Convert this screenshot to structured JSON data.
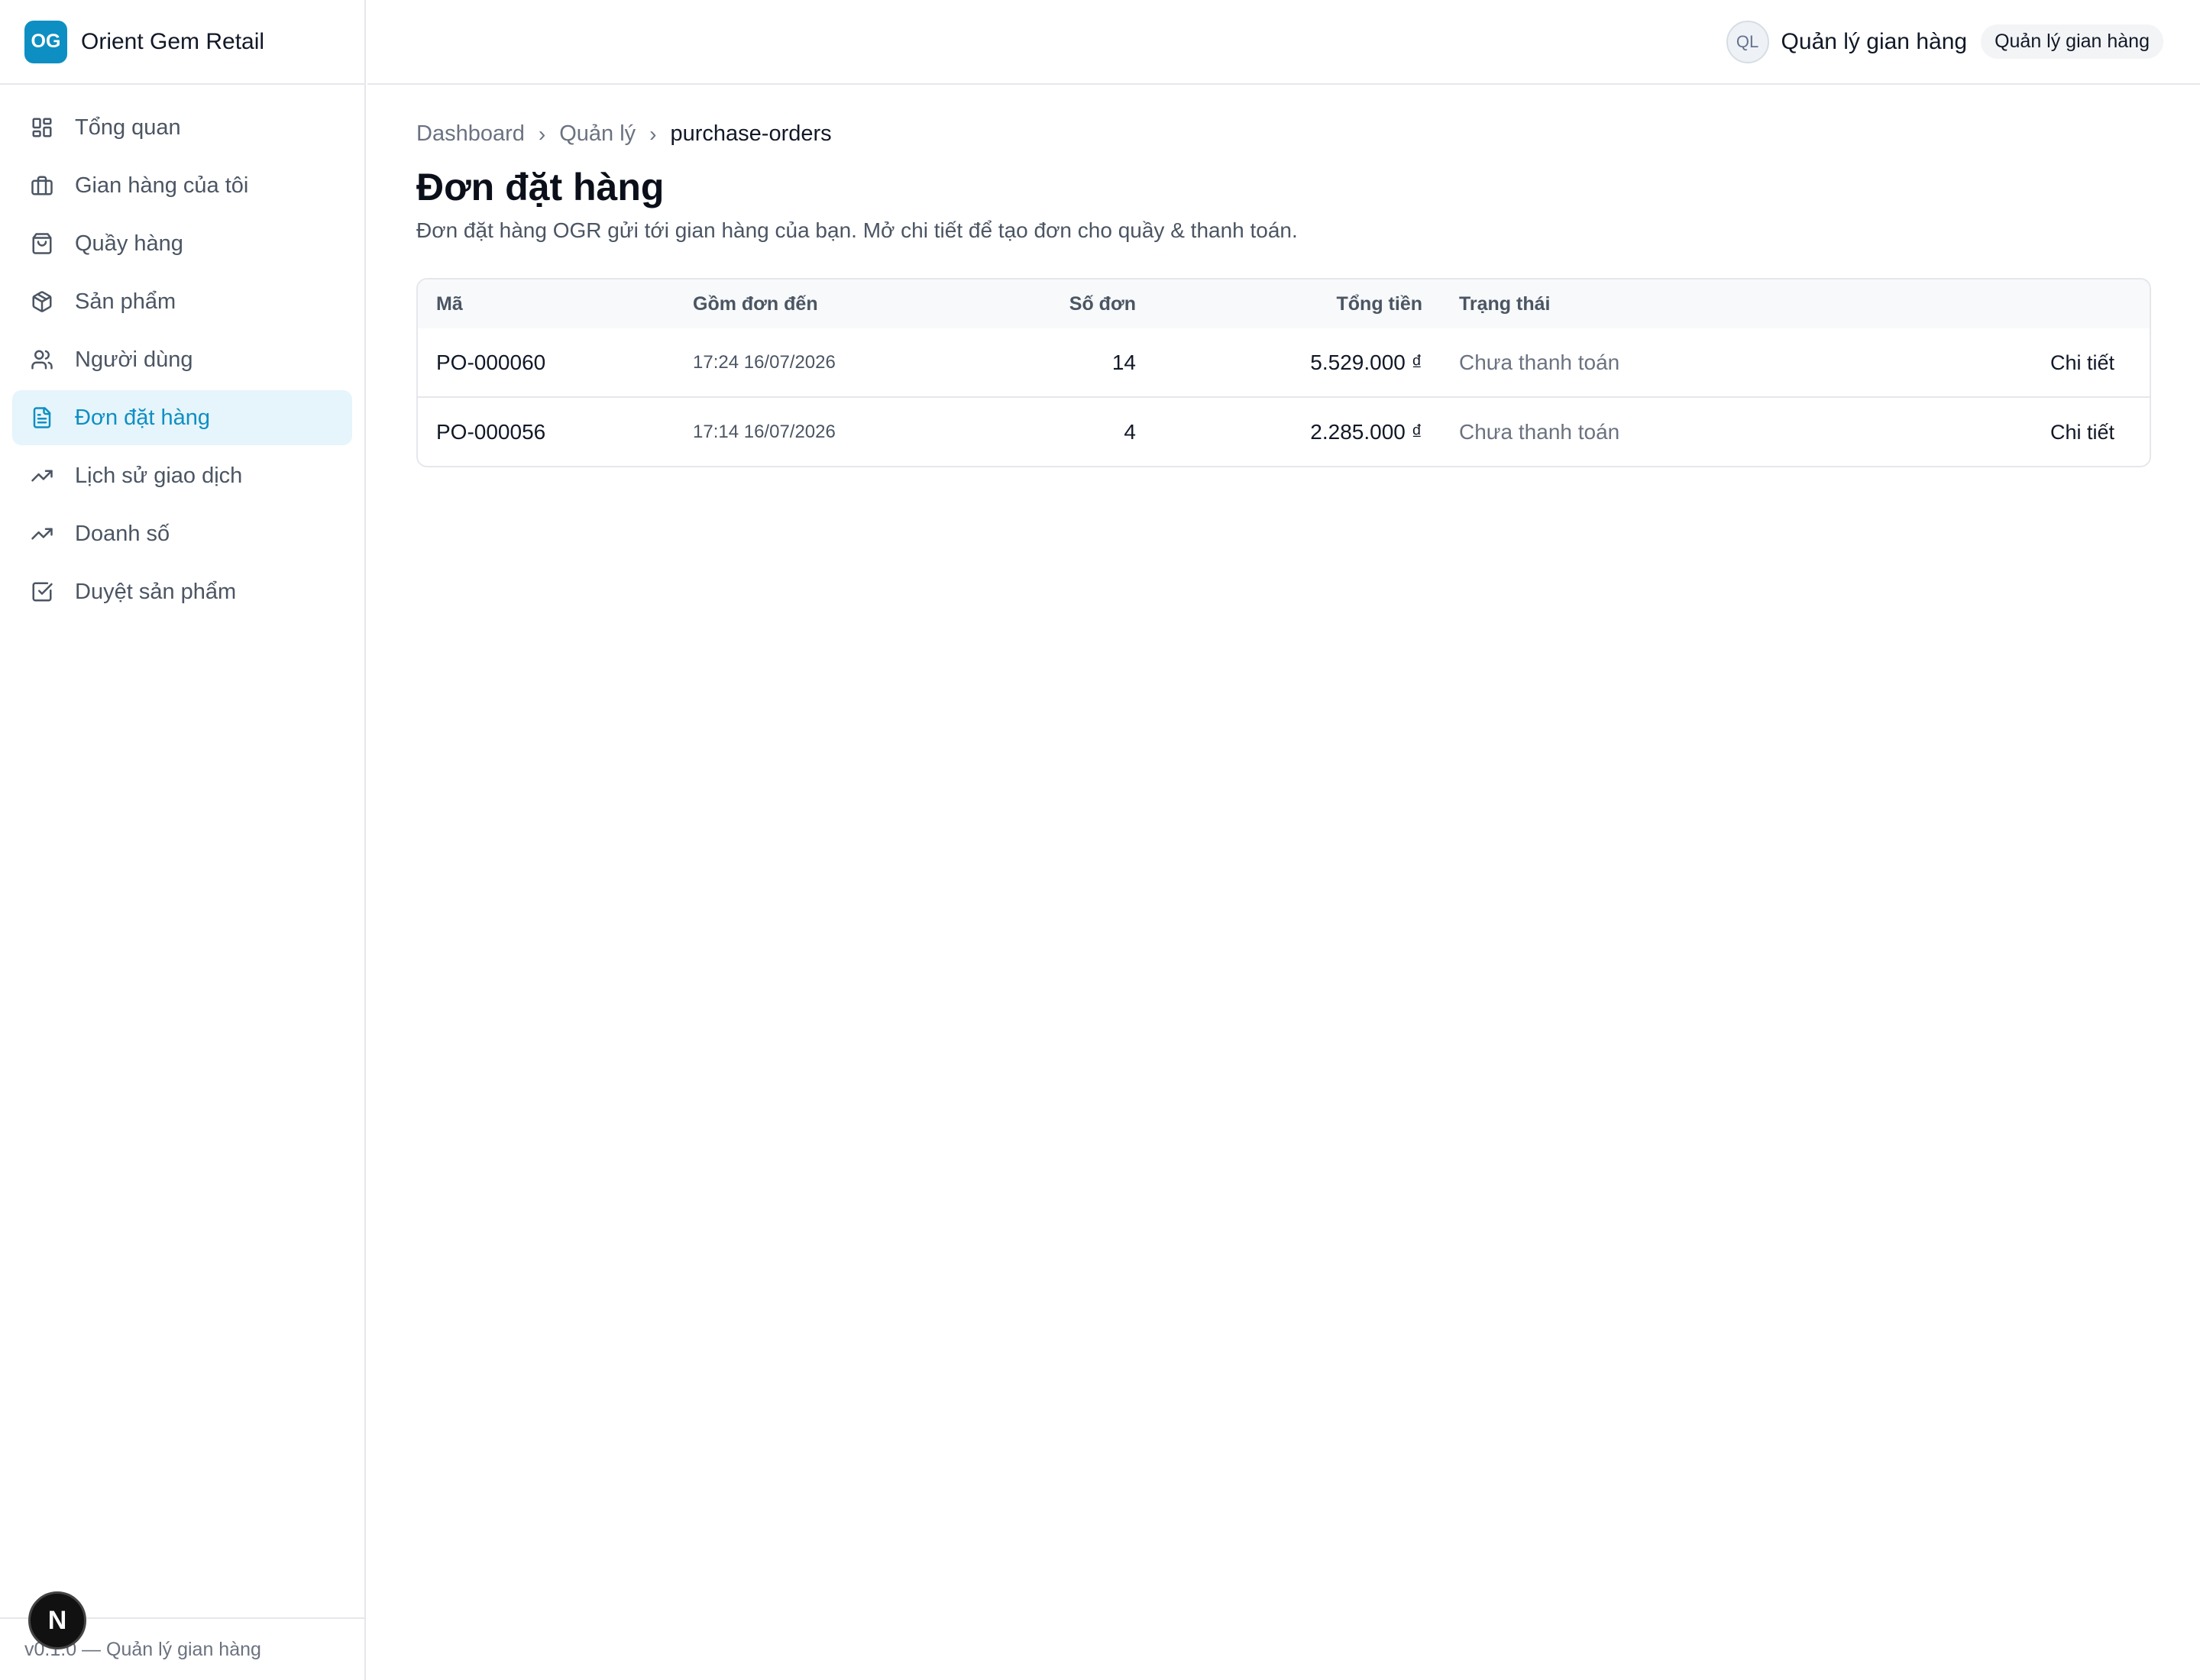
{
  "brand": {
    "logo": "OG",
    "name": "Orient Gem Retail",
    "accent": "#0e8fc3"
  },
  "sidebar": {
    "items": [
      {
        "label": "Tổng quan",
        "icon": "dashboard-grid-icon"
      },
      {
        "label": "Gian hàng của tôi",
        "icon": "briefcase-icon"
      },
      {
        "label": "Quầy hàng",
        "icon": "shopping-bag-icon"
      },
      {
        "label": "Sản phẩm",
        "icon": "package-icon"
      },
      {
        "label": "Người dùng",
        "icon": "users-icon"
      },
      {
        "label": "Đơn đặt hàng",
        "icon": "file-text-icon",
        "active": true
      },
      {
        "label": "Lịch sử giao dịch",
        "icon": "trending-up-icon"
      },
      {
        "label": "Doanh số",
        "icon": "trending-up-icon"
      },
      {
        "label": "Duyệt sản phẩm",
        "icon": "check-square-icon"
      }
    ],
    "footer": "v0.1.0 — Quản lý gian hàng",
    "dev_badge": "N"
  },
  "topbar": {
    "avatar": "QL",
    "user_name": "Quản lý gian hàng",
    "role": "Quản lý gian hàng"
  },
  "breadcrumb": [
    "Dashboard",
    "Quản lý",
    "purchase-orders"
  ],
  "page": {
    "title": "Đơn đặt hàng",
    "description": "Đơn đặt hàng OGR gửi tới gian hàng của bạn. Mở chi tiết để tạo đơn cho quầy & thanh toán."
  },
  "table": {
    "headers": {
      "code": "Mã",
      "date": "Gồm đơn đến",
      "count": "Số đơn",
      "total": "Tổng tiền",
      "status": "Trạng thái"
    },
    "rows": [
      {
        "code": "PO-000060",
        "date": "17:24 16/07/2026",
        "count": "14",
        "total": "5.529.000 ₫",
        "status": "Chưa thanh toán",
        "action": "Chi tiết"
      },
      {
        "code": "PO-000056",
        "date": "17:14 16/07/2026",
        "count": "4",
        "total": "2.285.000 ₫",
        "status": "Chưa thanh toán",
        "action": "Chi tiết"
      }
    ]
  }
}
